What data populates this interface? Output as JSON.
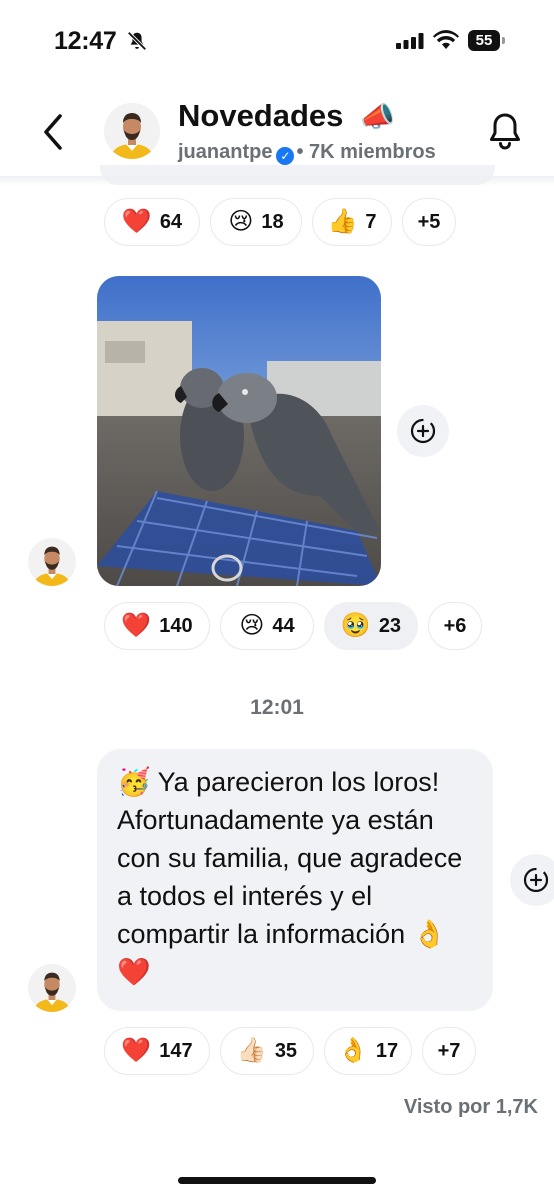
{
  "status_bar": {
    "time": "12:47",
    "battery": "55"
  },
  "header": {
    "title": "Novedades",
    "title_emoji": "📣",
    "username": "juanantpe",
    "members": "• 7K miembros"
  },
  "reactions_top": [
    {
      "emoji": "❤️",
      "count": "64"
    },
    {
      "emoji": "😢",
      "count": "18"
    },
    {
      "emoji": "👍",
      "count": "7"
    },
    {
      "more": "+5"
    }
  ],
  "reactions_photo": [
    {
      "emoji": "❤️",
      "count": "140"
    },
    {
      "emoji": "😢",
      "count": "44"
    },
    {
      "emoji": "🥹",
      "count": "23"
    },
    {
      "more": "+6"
    }
  ],
  "timestamp": "12:01",
  "message": {
    "emoji": "🥳",
    "text": "Ya parecieron los loros! Afortunadamente ya están con su familia, que agradece a todos el interés y el compartir la información",
    "end_emojis": "👌❤️"
  },
  "reactions_text": [
    {
      "emoji": "❤️",
      "count": "147"
    },
    {
      "emoji": "👍🏻",
      "count": "35"
    },
    {
      "emoji": "👌",
      "count": "17"
    },
    {
      "more": "+7"
    }
  ],
  "seen_by": "Visto por 1,7K",
  "icons": {
    "back": "chevron-left-icon",
    "notifications_muted": "bell-slash-icon",
    "notifications": "bell-icon",
    "add_reaction": "add-reaction-icon"
  }
}
